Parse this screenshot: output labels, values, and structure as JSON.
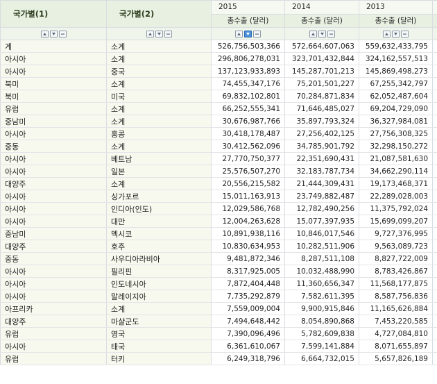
{
  "headers": {
    "dim1": "국가별(1)",
    "dim2": "국가별(2)",
    "years": [
      "2015",
      "2014",
      "2013"
    ],
    "measure": "총수출 (달러)"
  },
  "controls": {
    "sort_asc_icon": "arrow-up-icon",
    "sort_desc_icon": "arrow-down-icon",
    "filter_icon": "minus-icon"
  },
  "rows": [
    {
      "region": "계",
      "country": "소계",
      "v2015": "526,756,503,366",
      "v2014": "572,664,607,063",
      "v2013": "559,632,433,795"
    },
    {
      "region": "아시아",
      "country": "소계",
      "v2015": "296,806,278,031",
      "v2014": "323,701,432,844",
      "v2013": "324,162,557,513"
    },
    {
      "region": "아시아",
      "country": "중국",
      "v2015": "137,123,933,893",
      "v2014": "145,287,701,213",
      "v2013": "145,869,498,273"
    },
    {
      "region": "북미",
      "country": "소계",
      "v2015": "74,455,347,176",
      "v2014": "75,201,501,227",
      "v2013": "67,255,342,797"
    },
    {
      "region": "북미",
      "country": "미국",
      "v2015": "69,832,102,801",
      "v2014": "70,284,871,834",
      "v2013": "62,052,487,604"
    },
    {
      "region": "유럽",
      "country": "소계",
      "v2015": "66,252,555,341",
      "v2014": "71,646,485,027",
      "v2013": "69,204,729,090"
    },
    {
      "region": "중남미",
      "country": "소계",
      "v2015": "30,676,987,766",
      "v2014": "35,897,793,324",
      "v2013": "36,327,984,081"
    },
    {
      "region": "아시아",
      "country": "홍콩",
      "v2015": "30,418,178,487",
      "v2014": "27,256,402,125",
      "v2013": "27,756,308,325"
    },
    {
      "region": "중동",
      "country": "소계",
      "v2015": "30,412,562,096",
      "v2014": "34,785,901,792",
      "v2013": "32,298,150,272"
    },
    {
      "region": "아시아",
      "country": "베트남",
      "v2015": "27,770,750,377",
      "v2014": "22,351,690,431",
      "v2013": "21,087,581,630"
    },
    {
      "region": "아시아",
      "country": "일본",
      "v2015": "25,576,507,270",
      "v2014": "32,183,787,734",
      "v2013": "34,662,290,114"
    },
    {
      "region": "대양주",
      "country": "소계",
      "v2015": "20,556,215,582",
      "v2014": "21,444,309,431",
      "v2013": "19,173,468,371"
    },
    {
      "region": "아시아",
      "country": "싱가포르",
      "v2015": "15,011,163,913",
      "v2014": "23,749,882,487",
      "v2013": "22,289,028,003"
    },
    {
      "region": "아시아",
      "country": "인디아(인도)",
      "v2015": "12,029,586,768",
      "v2014": "12,782,490,256",
      "v2013": "11,375,792,024"
    },
    {
      "region": "아시아",
      "country": "대만",
      "v2015": "12,004,263,628",
      "v2014": "15,077,397,935",
      "v2013": "15,699,099,207"
    },
    {
      "region": "중남미",
      "country": "멕시코",
      "v2015": "10,891,938,116",
      "v2014": "10,846,017,546",
      "v2013": "9,727,376,995"
    },
    {
      "region": "대양주",
      "country": "호주",
      "v2015": "10,830,634,953",
      "v2014": "10,282,511,906",
      "v2013": "9,563,089,723"
    },
    {
      "region": "중동",
      "country": "사우디아라비아",
      "v2015": "9,481,872,346",
      "v2014": "8,287,511,108",
      "v2013": "8,827,722,009"
    },
    {
      "region": "아시아",
      "country": "필리핀",
      "v2015": "8,317,925,005",
      "v2014": "10,032,488,990",
      "v2013": "8,783,426,867"
    },
    {
      "region": "아시아",
      "country": "인도네시아",
      "v2015": "7,872,404,448",
      "v2014": "11,360,656,347",
      "v2013": "11,568,177,875"
    },
    {
      "region": "아시아",
      "country": "말레이지아",
      "v2015": "7,735,292,879",
      "v2014": "7,582,611,395",
      "v2013": "8,587,756,836"
    },
    {
      "region": "아프리카",
      "country": "소계",
      "v2015": "7,559,009,004",
      "v2014": "9,900,915,846",
      "v2013": "11,165,626,884"
    },
    {
      "region": "대양주",
      "country": "마샬군도",
      "v2015": "7,494,648,442",
      "v2014": "8,054,890,868",
      "v2013": "7,453,220,585"
    },
    {
      "region": "유럽",
      "country": "영국",
      "v2015": "7,390,096,496",
      "v2014": "5,782,609,838",
      "v2013": "4,727,084,810"
    },
    {
      "region": "아시아",
      "country": "태국",
      "v2015": "6,361,610,067",
      "v2014": "7,599,141,884",
      "v2013": "8,071,655,897"
    },
    {
      "region": "유럽",
      "country": "터키",
      "v2015": "6,249,318,796",
      "v2014": "6,664,732,015",
      "v2013": "5,657,826,189"
    }
  ]
}
